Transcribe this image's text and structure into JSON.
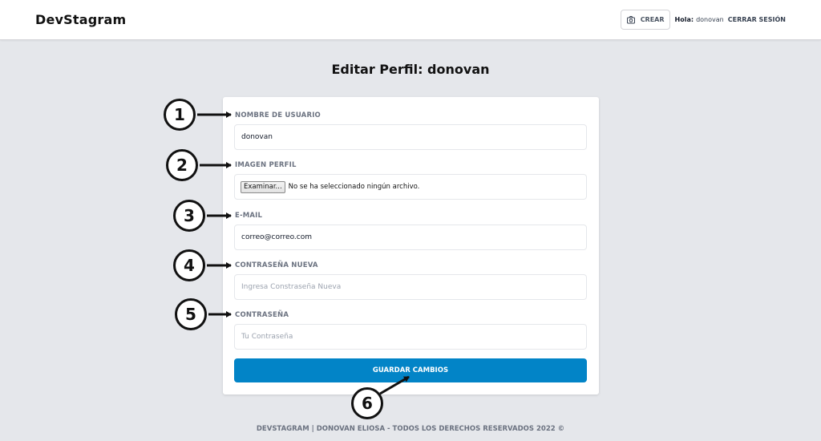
{
  "header": {
    "brand": "DevStagram",
    "create_label": "CREAR",
    "hello_label": "Hola:",
    "username": "donovan",
    "logout_label": "CERRAR SESIÓN"
  },
  "page": {
    "title": "Editar Perfil: donovan"
  },
  "form": {
    "username_label": "NOMBRE DE USUARIO",
    "username_value": "donovan",
    "image_label": "IMAGEN PERFIL",
    "file_button_label": "Examinar...",
    "file_status": "No se ha seleccionado ningún archivo.",
    "email_label": "E-MAIL",
    "email_value": "correo@correo.com",
    "new_password_label": "CONTRASEÑA NUEVA",
    "new_password_placeholder": "Ingresa Constraseña Nueva",
    "password_label": "CONTRASEÑA",
    "password_placeholder": "Tu Contraseña",
    "submit_label": "GUARDAR CAMBIOS"
  },
  "callouts": [
    "1",
    "2",
    "3",
    "4",
    "5",
    "6"
  ],
  "footer": {
    "text": "DEVSTAGRAM | DONOVAN ELIOSA - TODOS LOS DERECHOS RESERVADOS 2022 ©"
  }
}
